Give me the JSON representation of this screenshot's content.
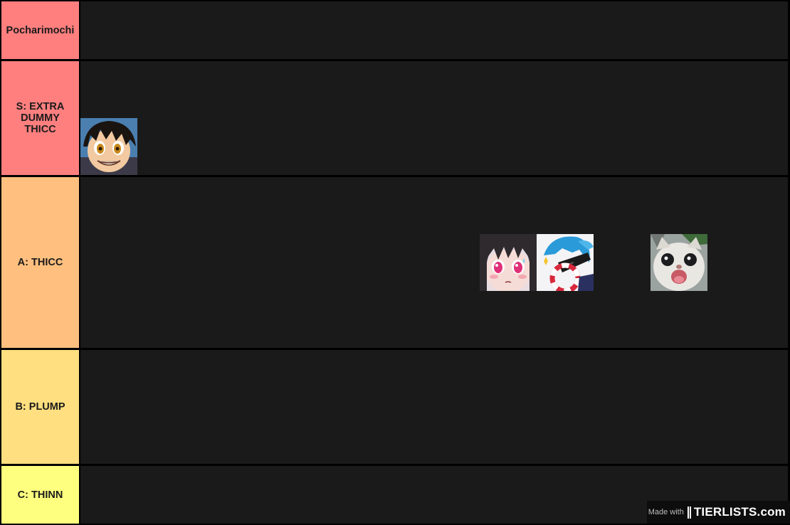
{
  "tiers": [
    {
      "label": "Pocharimochi",
      "color": "#ff7f7f"
    },
    {
      "label": "S: EXTRA DUMMY THICC",
      "color": "#ff7f7f"
    },
    {
      "label": "A: THICC",
      "color": "#ffbf7f"
    },
    {
      "label": "B: PLUMP",
      "color": "#ffdf7f"
    },
    {
      "label": "C: THINN",
      "color": "#ffff7f"
    }
  ],
  "items": [
    {
      "tier": 1,
      "icon": "anime-boy-grin-portrait"
    },
    {
      "tier": 2,
      "icon": "anime-girl-blush-portrait"
    },
    {
      "tier": 2,
      "icon": "blue-hair-sunglasses-portrait"
    },
    {
      "tier": 2,
      "icon": "surprised-cat-portrait"
    }
  ],
  "watermark": {
    "made_with": "Made with",
    "brand": "TIERLISTS.com"
  },
  "colors": {
    "row_bg": "#1a1a1a",
    "border": "#000000"
  }
}
